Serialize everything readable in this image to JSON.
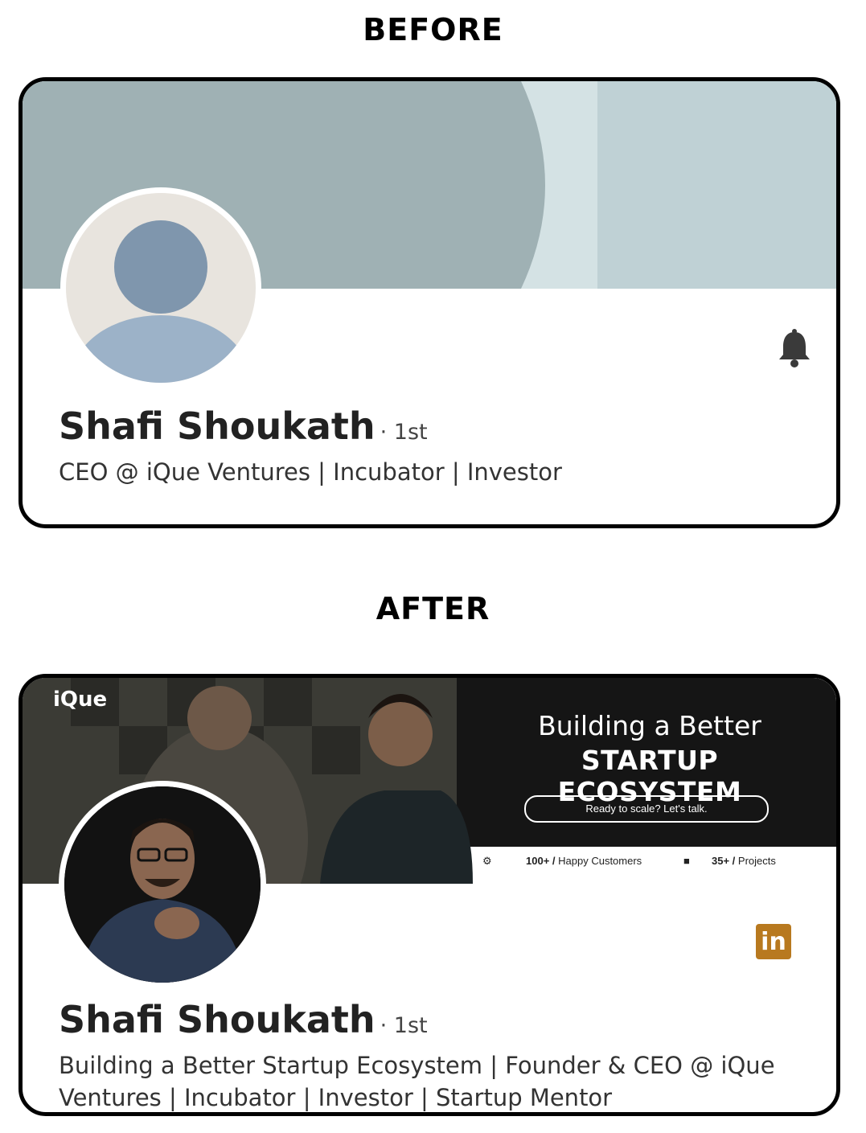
{
  "before": {
    "section_title": "BEFORE",
    "profile": {
      "name": "Shafi Shoukath",
      "degree": "· 1st",
      "headline": "CEO @ iQue Ventures | Incubator | Investor"
    },
    "icons": {
      "notify": "bell-icon"
    },
    "colors": {
      "banner_light": "#bfd1d5",
      "banner_dark": "#9fb1b4"
    }
  },
  "after": {
    "section_title": "AFTER",
    "profile": {
      "name": "Shafi Shoukath",
      "degree": "· 1st",
      "headline_line1": "Building a Better Startup Ecosystem | Founder & CEO @ iQue",
      "headline_line2": "Ventures | Incubator | Investor | Startup Mentor"
    },
    "banner": {
      "logo": "iQue",
      "headline_line1": "Building a Better",
      "headline_line2": "STARTUP ECOSYSTEM",
      "cta": "Ready to scale? Let's talk.",
      "stats": [
        {
          "value": "100+ /",
          "label": "Happy Customers"
        },
        {
          "value": "35+ /",
          "label": "Projects"
        }
      ]
    },
    "icons": {
      "social": "linkedin-icon"
    },
    "linkedin_text": "in",
    "colors": {
      "linkedin": "#b8791f",
      "banner_dark": "#1a1a1a"
    }
  }
}
